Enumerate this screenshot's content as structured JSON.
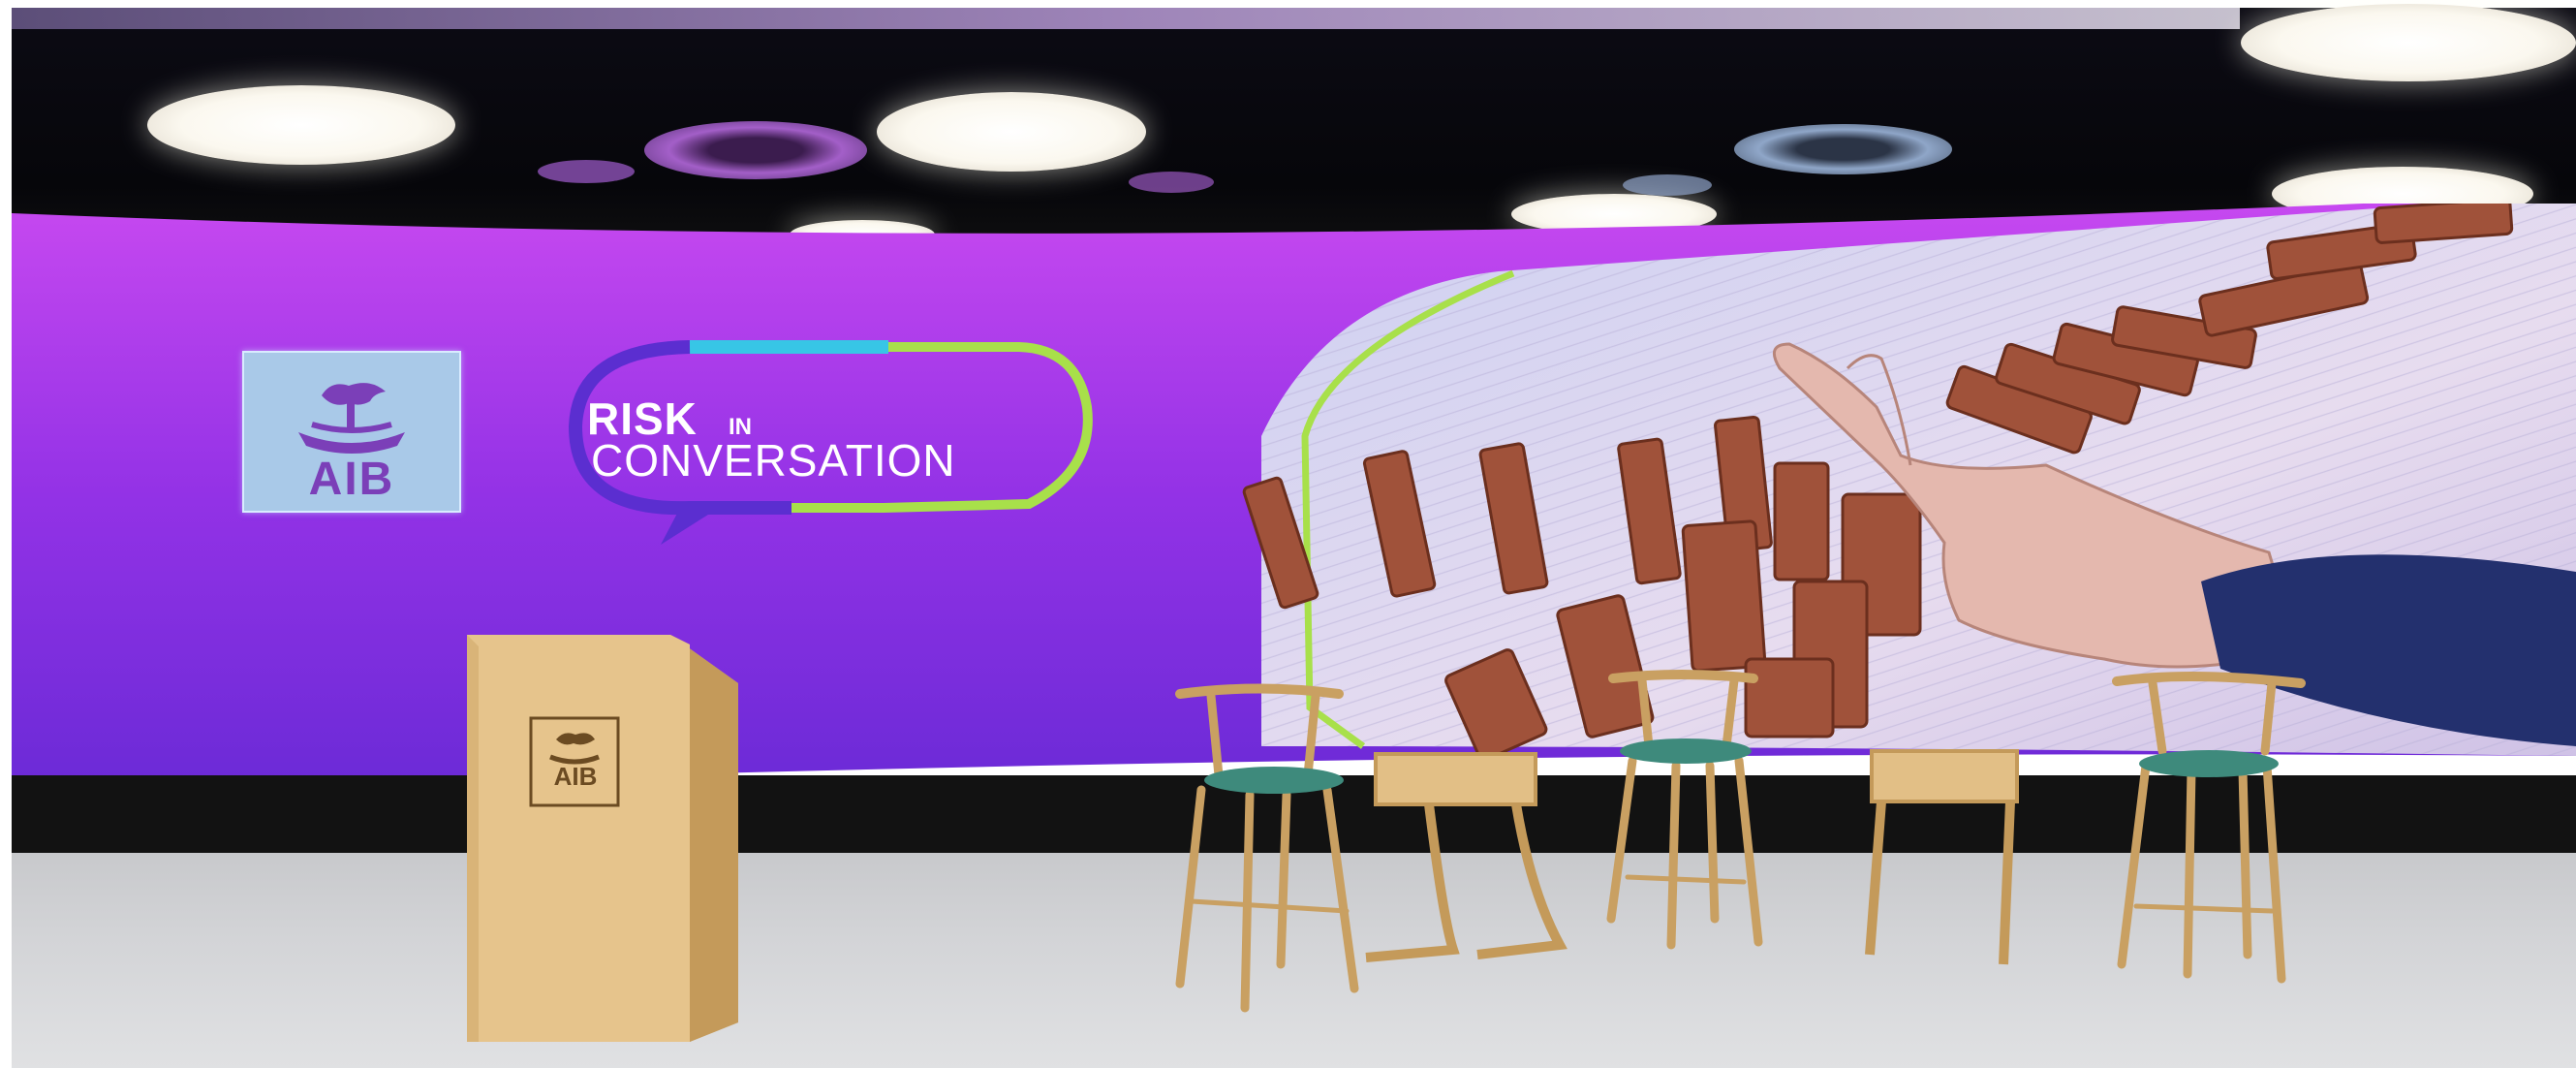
{
  "screen": {
    "logo_label": "AIB",
    "event_title_line1": "RISK",
    "event_title_small": "IN",
    "event_title_line2": "CONVERSATION"
  },
  "podium": {
    "logo_label": "AIB"
  },
  "colors": {
    "screen_purple": "#8a2be2",
    "screen_magenta": "#c440e8",
    "accent_lime": "#a8e04a",
    "accent_cyan": "#37c6e6",
    "podium_wood": "#e2bf86",
    "chair_seat": "#3e8a7c"
  }
}
